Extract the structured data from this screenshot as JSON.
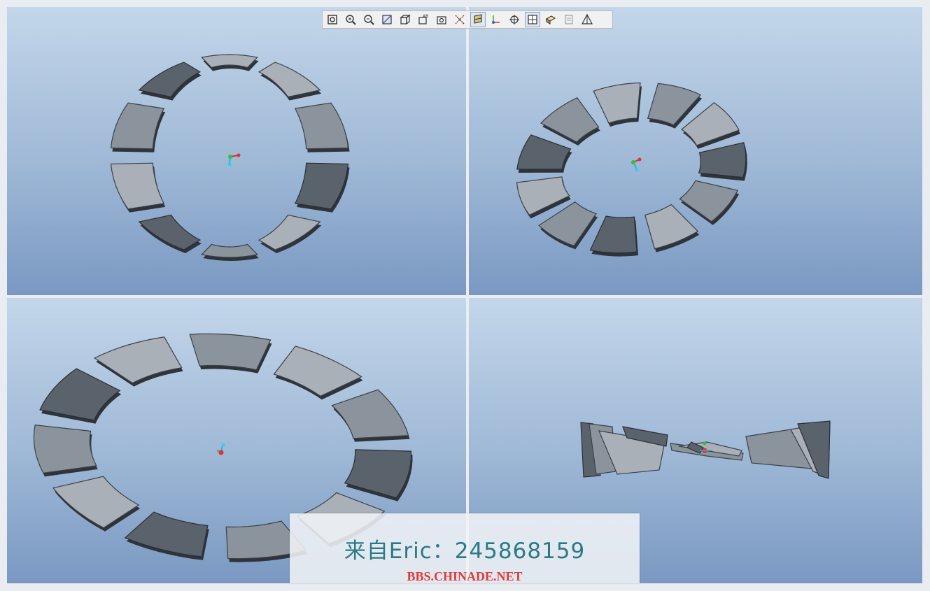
{
  "toolbar": {
    "buttons": [
      {
        "icon": "refit-icon",
        "active": false
      },
      {
        "icon": "zoom-in-icon",
        "active": false
      },
      {
        "icon": "zoom-out-icon",
        "active": false
      },
      {
        "icon": "repaint-icon",
        "active": false
      },
      {
        "icon": "saved-views-icon",
        "active": false
      },
      {
        "icon": "annotation-display-icon",
        "active": false
      },
      {
        "icon": "view-manager-icon",
        "active": false
      },
      {
        "icon": "axis-display-icon",
        "active": false
      },
      {
        "icon": "datum-plane-display-icon",
        "active": true
      },
      {
        "icon": "csys-display-icon",
        "active": false
      },
      {
        "icon": "spin-center-icon",
        "active": false
      },
      {
        "icon": "multi-view-icon",
        "active": true
      },
      {
        "icon": "cross-section-icon",
        "active": false
      },
      {
        "icon": "layers-icon",
        "active": false
      },
      {
        "icon": "perspective-icon",
        "active": false
      }
    ]
  },
  "viewports": [
    {
      "name": "top-left",
      "view": "front"
    },
    {
      "name": "top-right",
      "view": "tilted"
    },
    {
      "name": "bottom-left",
      "view": "isometric"
    },
    {
      "name": "bottom-right",
      "view": "edge"
    }
  ],
  "watermark": {
    "name": "来自Eric：245868159",
    "site": "BBS.CHINADE.NET"
  },
  "colors": {
    "viewport_top": "#c3d6ea",
    "viewport_bottom": "#7a98c2",
    "segment": "#8b939d",
    "segment_dark": "#3a4048",
    "watermark_text": "#2a7a86",
    "watermark_site": "#e03a3a"
  }
}
